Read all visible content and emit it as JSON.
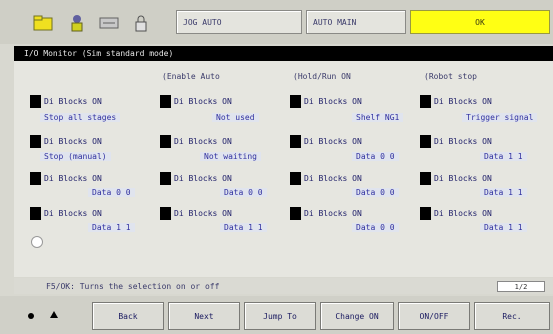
{
  "toolbar": {
    "field1": "JOG  AUTO",
    "field2": "AUTO  MAIN",
    "status": "OK"
  },
  "title": "I/O Monitor (Sim standard mode)",
  "legend": [
    "(Enable Auto",
    "(Hold/Run ON",
    "(Robot stop"
  ],
  "signals": [
    {
      "id": "S1",
      "label": "Di  Blocks ON",
      "sub": "Stop all stages"
    },
    {
      "id": "S2",
      "label": "Di  Blocks ON",
      "sub": "Not used"
    },
    {
      "id": "S3",
      "label": "Di  Blocks ON",
      "sub": "Shelf NG1"
    },
    {
      "id": "S4",
      "label": "Di  Blocks ON",
      "sub": "Trigger signal"
    },
    {
      "id": "S5",
      "label": "Di  Blocks ON",
      "sub": "Stop (manual)"
    },
    {
      "id": "S6",
      "label": "Di  Blocks ON",
      "sub": "Not waiting"
    },
    {
      "id": "S7",
      "label": "Di  Blocks ON",
      "sub": "Data 0 0"
    },
    {
      "id": "S8",
      "label": "Di  Blocks ON",
      "sub": "Data 1 1"
    },
    {
      "id": "S9",
      "label": "Di  Blocks ON",
      "sub": "Data 0 0"
    },
    {
      "id": "S10",
      "label": "Di  Blocks ON",
      "sub": "Data 0 0"
    },
    {
      "id": "S11",
      "label": "Di  Blocks ON",
      "sub": "Data 0 0"
    },
    {
      "id": "S12",
      "label": "Di  Blocks ON",
      "sub": "Data 1 1"
    },
    {
      "id": "S13",
      "label": "Di  Blocks ON",
      "sub": "Data 1 1"
    },
    {
      "id": "S14",
      "label": "Di  Blocks ON",
      "sub": "Data 1 1"
    },
    {
      "id": "S15",
      "label": "Di  Blocks ON",
      "sub": "Data 0 0"
    },
    {
      "id": "S16",
      "label": "Di  Blocks ON",
      "sub": "Data 1 1"
    }
  ],
  "message": "F5/OK: Turns the selection on or off",
  "page_indicator": "1/2",
  "buttons": [
    "Back",
    "Next",
    "Jump To",
    "Change ON",
    "ON/OFF",
    "Rec."
  ]
}
